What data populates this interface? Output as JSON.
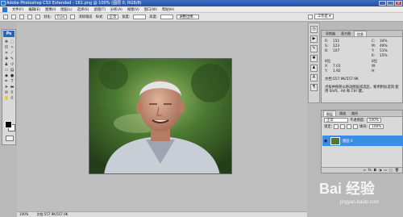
{
  "title": "Adobe Photoshop CS3 Extended - 161.png @ 100% (图层 0, RGB/8)",
  "menu": [
    "文件(F)",
    "编辑(E)",
    "图像(I)",
    "图层(L)",
    "选择(S)",
    "滤镜(T)",
    "分析(A)",
    "视图(V)",
    "窗口(W)",
    "帮助(H)"
  ],
  "options": {
    "feather_label": "羽化:",
    "feather_value": "0 px",
    "antialias_label": "消除锯齿",
    "style_label": "样式:",
    "style_value": "正常",
    "width_label": "宽度:",
    "height_label": "高度:",
    "refine_label": "调整边缘...",
    "workspace_label": "工作区 ▾"
  },
  "toolbox": {
    "logo": "Ps"
  },
  "info_panel": {
    "tabs": [
      "导航器",
      "直方图",
      "信息"
    ],
    "active_tab": "信息",
    "r_label": "R:",
    "r_value": "151",
    "g_label": "G:",
    "g_value": "123",
    "b_label": "B:",
    "b_value": "107",
    "bit1": "8位",
    "c_label": "C:",
    "c_value": "34%",
    "m_label": "M:",
    "m_value": "49%",
    "y_label": "Y:",
    "y_value": "51%",
    "k_label": "K:",
    "k_value": "15%",
    "bit2": "8位",
    "x_label": "X:",
    "x_value": "7.01",
    "yy_label": "Y:",
    "yy_value": "1.92",
    "w_label": "W:",
    "h_label": "H:",
    "doc_size": "文档:557.9K/557.9K",
    "hint": "点按并拖移以移动图层或选区。要用附加选项,使用 Shift、Alt 和 Ctrl 键。"
  },
  "layers_panel": {
    "tabs": [
      "图层",
      "通道",
      "路径"
    ],
    "active_tab": "图层",
    "blend_mode": "正常",
    "opacity_label": "不透明度:",
    "opacity_value": "100%",
    "lock_label": "锁定:",
    "fill_label": "填充:",
    "fill_value": "100%",
    "layer_name": "图层 0"
  },
  "status": {
    "zoom": "100%",
    "doc_size": "文档:557.9K/557.9K"
  },
  "watermark": {
    "text": "Bai 经验",
    "sub": "jingyan.baidu.com"
  }
}
